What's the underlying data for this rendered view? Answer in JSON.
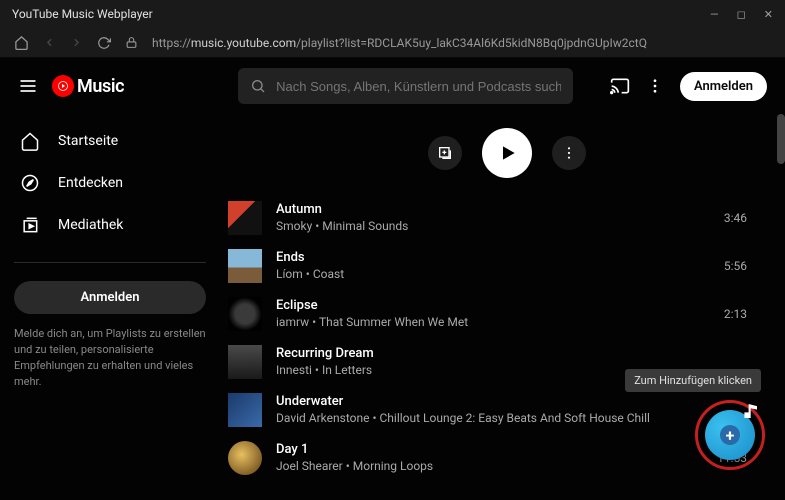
{
  "window": {
    "title": "YouTube Music Webplayer"
  },
  "url": {
    "host": "music.youtube.com",
    "path": "/playlist?list=RDCLAK5uy_lakC34Al6Kd5kidN8Bq0jpdnGUpIw2ctQ"
  },
  "brand": {
    "name": "Music"
  },
  "search": {
    "placeholder": "Nach Songs, Alben, Künstlern und Podcasts suchen"
  },
  "topbar": {
    "signin": "Anmelden"
  },
  "sidebar": {
    "items": [
      {
        "label": "Startseite"
      },
      {
        "label": "Entdecken"
      },
      {
        "label": "Mediathek"
      }
    ],
    "signin": "Anmelden",
    "blurb": "Melde dich an, um Playlists zu erstellen und zu teilen, personalisierte Empfehlungen zu erhalten und vieles mehr."
  },
  "tracks": [
    {
      "title": "Autumn",
      "artist": "Smoky",
      "album": "Minimal Sounds",
      "duration": "3:46"
    },
    {
      "title": "Ends",
      "artist": "Líom",
      "album": "Coast",
      "duration": "5:56"
    },
    {
      "title": "Eclipse",
      "artist": "iamrw",
      "album": "That Summer When We Met",
      "duration": "2:13"
    },
    {
      "title": "Recurring Dream",
      "artist": "Innesti",
      "album": "In Letters",
      "duration": ""
    },
    {
      "title": "Underwater",
      "artist": "David Arkenstone",
      "album": "Chillout Lounge 2: Easy Beats And Soft House Chill",
      "duration": ""
    },
    {
      "title": "Day 1",
      "artist": "Joel Shearer",
      "album": "Morning Loops",
      "duration": "11:53"
    }
  ],
  "tooltip": {
    "text": "Zum Hinzufügen klicken"
  }
}
